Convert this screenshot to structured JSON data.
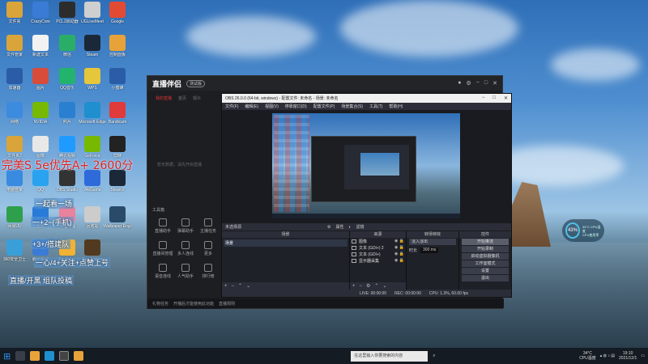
{
  "desktop": {
    "icons": [
      {
        "label": "文件夹",
        "color": "#d9a43a"
      },
      {
        "label": "CrazyCore",
        "color": "#3a7bd5"
      },
      {
        "label": "PCL2启动器",
        "color": "#2c2c2c"
      },
      {
        "label": "UGLiveMeet",
        "color": "#cfcfcf"
      },
      {
        "label": "Google",
        "color": "#e34a33"
      },
      {
        "label": "文件管家",
        "color": "#d9a43a"
      },
      {
        "label": "新建文本",
        "color": "#f2f2f2"
      },
      {
        "label": "微信",
        "color": "#2aae67"
      },
      {
        "label": "Steam",
        "color": "#1b2838"
      },
      {
        "label": "控制面板",
        "color": "#e8a23a"
      },
      {
        "label": "加速器",
        "color": "#2a5ca8"
      },
      {
        "label": "图片",
        "color": "#d94c3a"
      },
      {
        "label": "QQ音乐",
        "color": "#23b36d"
      },
      {
        "label": "WPS",
        "color": "#e6c63a"
      },
      {
        "label": "小蜜蜂",
        "color": "#2a5ca8"
      },
      {
        "label": "网络",
        "color": "#3d8bdf"
      },
      {
        "label": "NVIDIA",
        "color": "#76b900"
      },
      {
        "label": "照片",
        "color": "#2a7fd0"
      },
      {
        "label": "Microsoft Edge",
        "color": "#1f8fcf"
      },
      {
        "label": "Bandicam",
        "color": "#e03a3a"
      },
      {
        "label": "文件夹2",
        "color": "#d9a43a"
      },
      {
        "label": "图像",
        "color": "#e8e8e8"
      },
      {
        "label": "腾讯视频",
        "color": "#1f9bff"
      },
      {
        "label": "GeForce",
        "color": "#76b900"
      },
      {
        "label": "剪映",
        "color": "#222222"
      },
      {
        "label": "电脑管家",
        "color": "#3a8adf"
      },
      {
        "label": "QQ",
        "color": "#29a3f0"
      },
      {
        "label": "OBS Studio",
        "color": "#333333"
      },
      {
        "label": "WeGame",
        "color": "#2e6ad9"
      },
      {
        "label": "Steam2",
        "color": "#1b2838"
      },
      {
        "label": "网易UU",
        "color": "#2e9f4a"
      },
      {
        "label": "迅雷",
        "color": "#2a7bd8"
      },
      {
        "label": "哔哩哔哩",
        "color": "#e9829c"
      },
      {
        "label": "回收站",
        "color": "#cccccc"
      },
      {
        "label": "Wallpaper Engine",
        "color": "#2a4a6a"
      },
      {
        "label": "360安全卫士",
        "color": "#3a9fd8"
      },
      {
        "label": "腾讯会议",
        "color": "#3a7bd5"
      },
      {
        "label": "Rockstar",
        "color": "#f2b233"
      },
      {
        "label": "Bee Nature",
        "color": "#523a20"
      }
    ]
  },
  "overlay": {
    "headline": "完美S 5e优先A+ 2600分",
    "lines": [
      "一起看一场",
      "一+2~(手机)",
      "+3+/搭建队",
      "一心/4+关注+点赞上号",
      "直播/开黑 组队投稿"
    ]
  },
  "live_app": {
    "title": "直播伴侣",
    "badge": "测试版",
    "tabs": [
      "我的直播",
      "首页",
      "观众"
    ],
    "hint": "暂无数据，请先开启直播",
    "tools_title": "工具箱",
    "tools": [
      "直播助手",
      "弹幕助手",
      "主播任务",
      "直播间管理",
      "多人连线",
      "更多",
      "语音连线",
      "人气助手",
      "排行榜"
    ],
    "bottom": [
      "礼物任务",
      "开播后才能使用此功能",
      "直播规则"
    ]
  },
  "obs": {
    "title": "OBS 26.0.0 (64-bit, windows) - 配置文件: 未命名 - 场景: 未命名",
    "menu": [
      "文件(F)",
      "编辑(E)",
      "视图(V)",
      "停靠窗口(D)",
      "配置文件(P)",
      "场景集合(S)",
      "工具(T)",
      "帮助(H)"
    ],
    "scene_bar": {
      "label": "未选择源",
      "properties": "属性",
      "filters": "滤镜"
    },
    "docks": {
      "scenes": {
        "title": "场景",
        "items": [
          "场景"
        ]
      },
      "sources": {
        "title": "来源",
        "items": [
          {
            "name": "图像",
            "type": "image"
          },
          {
            "name": "文本 (GDI+) 2",
            "type": "text"
          },
          {
            "name": "文本 (GDI+)",
            "type": "text"
          },
          {
            "name": "显示器采集",
            "type": "display"
          }
        ]
      },
      "mixer": {
        "title": "混音器",
        "label": "桌面音频",
        "level": "0.0 dB"
      },
      "transitions": {
        "title": "转场特效",
        "type": "淡入淡出",
        "duration_label": "时长",
        "duration": "300 ms"
      },
      "controls": {
        "title": "控件",
        "buttons": [
          "开始推流",
          "开始录制",
          "启动虚拟摄像机",
          "工作室模式",
          "设置",
          "退出"
        ]
      }
    },
    "status": [
      "LIVE: 00:00:00",
      "REC: 00:00:00",
      "CPU: 1.3%, 60.00 fps"
    ]
  },
  "widget": {
    "percent": "43%",
    "line1": "34°C CPU温度",
    "line2": "CPU使用率"
  },
  "taskbar": {
    "search_placeholder": "在这里输入你要搜索的内容",
    "temp": "34°C",
    "temp_label": "CPU温度",
    "time": "19:10",
    "date": "2021/12/1"
  }
}
